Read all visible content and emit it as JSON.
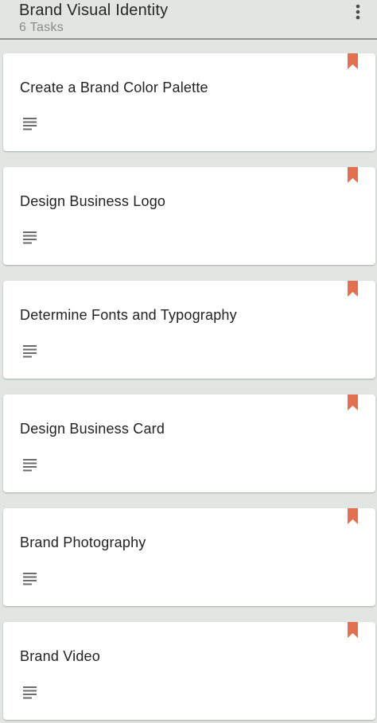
{
  "header": {
    "title": "Brand Visual Identity",
    "task_count": "6 Tasks",
    "menu_icon": "more-vert-icon"
  },
  "colors": {
    "background": "#e1e6e3",
    "card": "#ffffff",
    "bookmark": "#e2724f",
    "text_primary": "#222222",
    "text_secondary": "#8a8d8b",
    "description_icon": "#6b6b6b"
  },
  "tasks": [
    {
      "title": "Create a Brand Color Palette",
      "has_description": true,
      "flag_icon": "bookmark-icon"
    },
    {
      "title": "Design Business Logo",
      "has_description": true,
      "flag_icon": "bookmark-icon"
    },
    {
      "title": "Determine Fonts and Typography",
      "has_description": true,
      "flag_icon": "bookmark-icon"
    },
    {
      "title": "Design Business Card",
      "has_description": true,
      "flag_icon": "bookmark-icon"
    },
    {
      "title": "Brand Photography",
      "has_description": true,
      "flag_icon": "bookmark-icon"
    },
    {
      "title": "Brand Video",
      "has_description": true,
      "flag_icon": "bookmark-icon"
    }
  ]
}
